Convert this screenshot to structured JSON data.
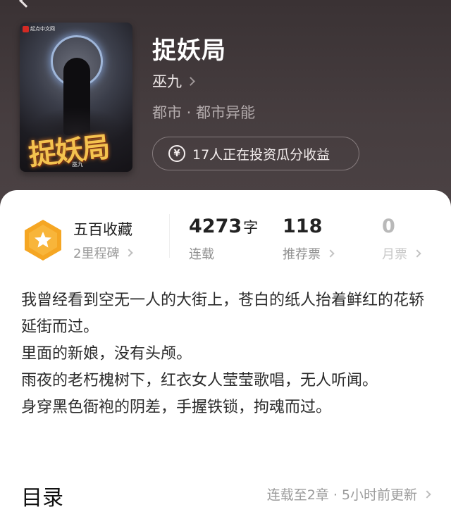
{
  "book": {
    "title": "捉妖局",
    "author": "巫九",
    "genre": "都市 · 都市异能",
    "invest_text": "17人正在投资瓜分收益",
    "cover": {
      "publisher_tag": "起点中文网",
      "title_art": "捉妖局",
      "author_art": "巫九"
    }
  },
  "stats": {
    "milestone": {
      "title": "五百收藏",
      "subtitle": "2里程碑"
    },
    "words": {
      "value": "4273",
      "unit": "字",
      "label": "连载"
    },
    "recommend": {
      "value": "118",
      "label": "推荐票"
    },
    "monthly": {
      "value": "0",
      "label": "月票"
    }
  },
  "synopsis": [
    "我曾经看到空无一人的大街上，苍白的纸人抬着鲜红的花轿延街而过。",
    "里面的新娘，没有头颅。",
    "雨夜的老朽槐树下，红衣女人莹莹歌唱，无人听闻。",
    "身穿黑色衙袍的阴差，手握铁锁，拘魂而过。"
  ],
  "toc": {
    "title": "目录",
    "update": "连载至2章 · 5小时前更新"
  },
  "colors": {
    "badge_orange": "#f5a623",
    "header_bg": "#3e3638"
  }
}
